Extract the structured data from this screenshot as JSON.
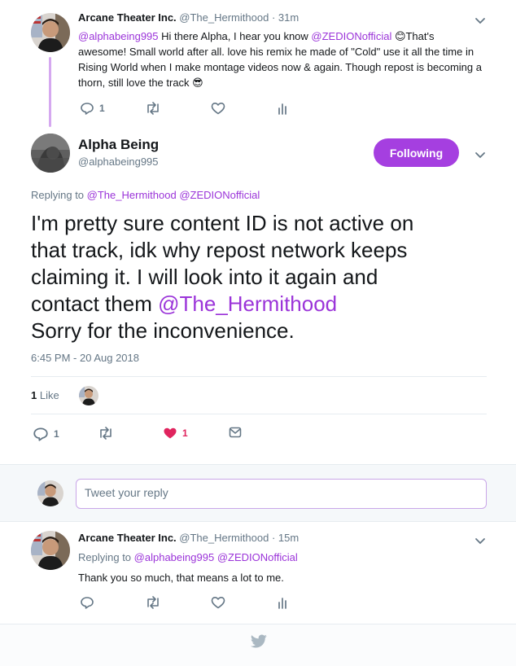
{
  "tweet1": {
    "author_name": "Arcane Theater Inc.",
    "author_handle": "@The_Hermithood",
    "separator": "·",
    "time": "31m",
    "text_parts": [
      {
        "t": "@alphabeing995",
        "link": true
      },
      {
        "t": " Hi there Alpha, I hear you know ",
        "link": false
      },
      {
        "t": "@ZEDIONofficial",
        "link": true
      },
      {
        "t": " 😊That's awesome! Small world after all. love his remix he made of \"Cold\" use it all the time in Rising World when I make montage videos now & again. Though repost is becoming a thorn, still love the track 😎",
        "link": false
      }
    ],
    "reply_count": "1",
    "retweet_count": "",
    "like_count": ""
  },
  "main_tweet": {
    "author_name": "Alpha Being",
    "author_handle": "@alphabeing995",
    "follow_label": "Following",
    "replying_prefix": "Replying to",
    "replying_to": [
      "@The_Hermithood",
      "@ZEDIONofficial"
    ],
    "text_line1": "I'm pretty sure content ID is not active on",
    "text_line2": "that track, idk why repost network keeps",
    "text_line3": "claiming it. I will look into it again and",
    "text_line4_prefix": "contact them ",
    "text_line4_mention": "@The_Hermithood",
    "text_line5": "Sorry for the inconvenience.",
    "timestamp": "6:45 PM - 20 Aug 2018",
    "likes_count": "1",
    "likes_label": "Like",
    "reply_count": "1",
    "retweet_count": "",
    "like_count": "1"
  },
  "reply_box": {
    "placeholder": "Tweet your reply"
  },
  "tweet3": {
    "author_name": "Arcane Theater Inc.",
    "author_handle": "@The_Hermithood",
    "separator": "·",
    "time": "15m",
    "replying_prefix": "Replying to",
    "replying_to": [
      "@alphabeing995",
      "@ZEDIONofficial"
    ],
    "text": "Thank you so much, that means a lot to me."
  },
  "colors": {
    "accent": "#a53fe0",
    "link": "#9b34d9",
    "like_red": "#e0245e",
    "thread_line": "#d5a8f0",
    "muted": "#657786"
  },
  "icons": [
    "reply-icon",
    "retweet-icon",
    "like-icon",
    "analytics-icon",
    "dm-icon",
    "chevron-down-icon",
    "twitter-bird-icon"
  ]
}
